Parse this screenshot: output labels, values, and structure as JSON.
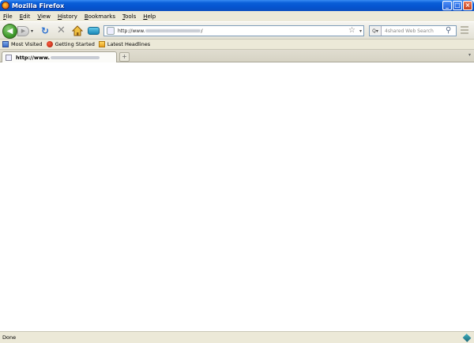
{
  "window": {
    "title": "Mozilla Firefox",
    "controls": {
      "minimize": "_",
      "maximize": "□",
      "close": "×"
    }
  },
  "menu": [
    {
      "label": "File",
      "accel": "F",
      "rest": "ile"
    },
    {
      "label": "Edit",
      "accel": "E",
      "rest": "dit"
    },
    {
      "label": "View",
      "accel": "V",
      "rest": "iew"
    },
    {
      "label": "History",
      "accel": "H",
      "rest": "istory"
    },
    {
      "label": "Bookmarks",
      "accel": "B",
      "rest": "ookmarks"
    },
    {
      "label": "Tools",
      "accel": "T",
      "rest": "ools"
    },
    {
      "label": "Help",
      "accel": "H",
      "rest": "elp"
    }
  ],
  "navigation": {
    "back_glyph": "◀",
    "forward_glyph": "▶",
    "history_dropdown_glyph": "▾",
    "reload_glyph": "↻",
    "stop_glyph": "✕",
    "address_prefix": "http://www.",
    "address_suffix": "/",
    "bookmark_star_glyph": "☆",
    "address_dropdown_glyph": "▾",
    "search_placeholder": "4shared Web Search",
    "search_engine_glyph": "Q▾",
    "search_go_glyph": "⚲"
  },
  "bookmarks_toolbar": [
    {
      "label": "Most Visited",
      "icon": "most-visited-icon"
    },
    {
      "label": "Getting Started",
      "icon": "firefox-getting-started-icon"
    },
    {
      "label": "Latest Headlines",
      "icon": "rss-folder-icon"
    }
  ],
  "tabs": {
    "active_tab_prefix": "http://www.",
    "new_tab_glyph": "+",
    "scroll_glyph": "▾"
  },
  "statusbar": {
    "text": "Done"
  }
}
